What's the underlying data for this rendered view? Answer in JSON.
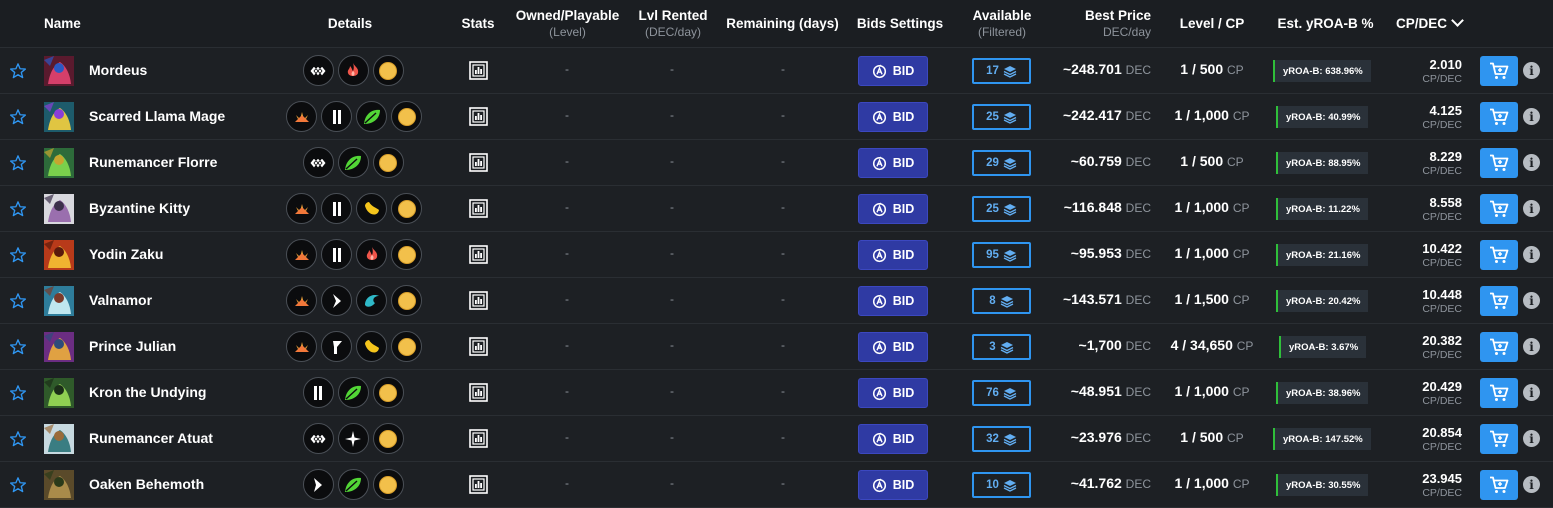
{
  "header": {
    "name": "Name",
    "details": "Details",
    "stats": "Stats",
    "owned": "Owned/Playable",
    "owned_sub": "(Level)",
    "lvl_rented": "Lvl Rented",
    "lvl_rented_sub": "(DEC/day)",
    "remaining": "Remaining (days)",
    "bids_settings": "Bids Settings",
    "available": "Available",
    "available_sub": "(Filtered)",
    "best_price": "Best Price",
    "best_price_sub": "DEC/day",
    "level_cp": "Level / CP",
    "yroa": "Est. yROA-B %",
    "cpdec": "CP/DEC"
  },
  "colors": {
    "background": "#1b1e22",
    "bid_button": "#2f3aa3",
    "accent_blue": "#2f95f0",
    "yroa_green": "#2fbf3a"
  },
  "common": {
    "dash": "-",
    "bid_label": "BID",
    "dec_unit": "DEC",
    "cp_unit": "CP",
    "cpdec_unit": "CP/DEC",
    "info_glyph": "i"
  },
  "rows": [
    {
      "name": "Mordeus",
      "details": [
        "diamond",
        "fire",
        "gold"
      ],
      "available": "17",
      "price": "~248.701",
      "level": "1 / 500",
      "yroa": "yROA-B: 638.96%",
      "cpdec": "2.010"
    },
    {
      "name": "Scarred Llama Mage",
      "details": [
        "sparks",
        "bar",
        "leaf",
        "gold"
      ],
      "available": "25",
      "price": "~242.417",
      "level": "1 / 1,000",
      "yroa": "yROA-B: 40.99%",
      "cpdec": "4.125"
    },
    {
      "name": "Runemancer Florre",
      "details": [
        "diamond",
        "leaf",
        "gold"
      ],
      "available": "29",
      "price": "~60.759",
      "level": "1 / 500",
      "yroa": "yROA-B: 88.95%",
      "cpdec": "8.229"
    },
    {
      "name": "Byzantine Kitty",
      "details": [
        "sparks",
        "bar",
        "lemon",
        "gold"
      ],
      "available": "25",
      "price": "~116.848",
      "level": "1 / 1,000",
      "yroa": "yROA-B: 11.22%",
      "cpdec": "8.558"
    },
    {
      "name": "Yodin Zaku",
      "details": [
        "sparks",
        "bar",
        "fire",
        "gold"
      ],
      "available": "95",
      "price": "~95.953",
      "level": "1 / 1,000",
      "yroa": "yROA-B: 21.16%",
      "cpdec": "10.422"
    },
    {
      "name": "Valnamor",
      "details": [
        "sparks",
        "bolt",
        "wave",
        "gold"
      ],
      "available": "8",
      "price": "~143.571",
      "level": "1 / 1,500",
      "yroa": "yROA-B: 20.42%",
      "cpdec": "10.448"
    },
    {
      "name": "Prince Julian",
      "details": [
        "sparks",
        "flag",
        "lemon",
        "gold"
      ],
      "available": "3",
      "price": "~1,700",
      "level": "4 / 34,650",
      "yroa": "yROA-B: 3.67%",
      "cpdec": "20.382"
    },
    {
      "name": "Kron the Undying",
      "details": [
        "bar",
        "leaf",
        "gold"
      ],
      "available": "76",
      "price": "~48.951",
      "level": "1 / 1,000",
      "yroa": "yROA-B: 38.96%",
      "cpdec": "20.429"
    },
    {
      "name": "Runemancer Atuat",
      "details": [
        "diamond",
        "star",
        "gold"
      ],
      "available": "32",
      "price": "~23.976",
      "level": "1 / 500",
      "yroa": "yROA-B: 147.52%",
      "cpdec": "20.854"
    },
    {
      "name": "Oaken Behemoth",
      "details": [
        "arrow",
        "leaf",
        "gold"
      ],
      "available": "10",
      "price": "~41.762",
      "level": "1 / 1,000",
      "yroa": "yROA-B: 30.55%",
      "cpdec": "23.945"
    }
  ]
}
